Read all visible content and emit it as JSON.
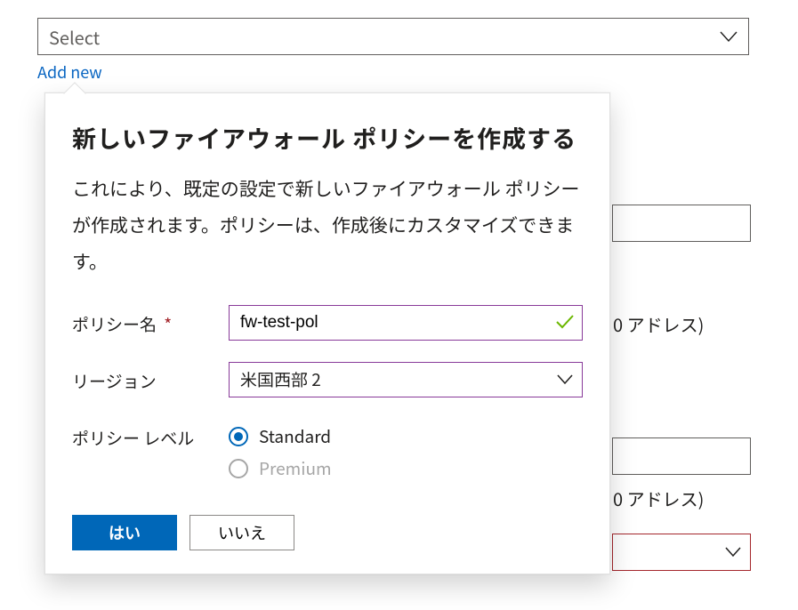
{
  "top_select": {
    "placeholder": "Select"
  },
  "add_new_label": "Add new",
  "callout": {
    "title": "新しいファイアウォール ポリシーを作成する",
    "description": "これにより、既定の設定で新しいファイアウォール ポリシーが作成されます。ポリシーは、作成後にカスタマイズできます。",
    "fields": {
      "policy_name": {
        "label": "ポリシー名",
        "required_mark": "*",
        "value": "fw-test-pol"
      },
      "region": {
        "label": "リージョン",
        "value": "米国西部 2"
      },
      "policy_tier": {
        "label": "ポリシー レベル",
        "options": {
          "standard": "Standard",
          "premium": "Premium"
        },
        "selected": "standard",
        "premium_disabled": true
      }
    },
    "buttons": {
      "yes": "はい",
      "no": "いいえ"
    }
  },
  "background": {
    "address_hint": "0 アドレス)"
  }
}
